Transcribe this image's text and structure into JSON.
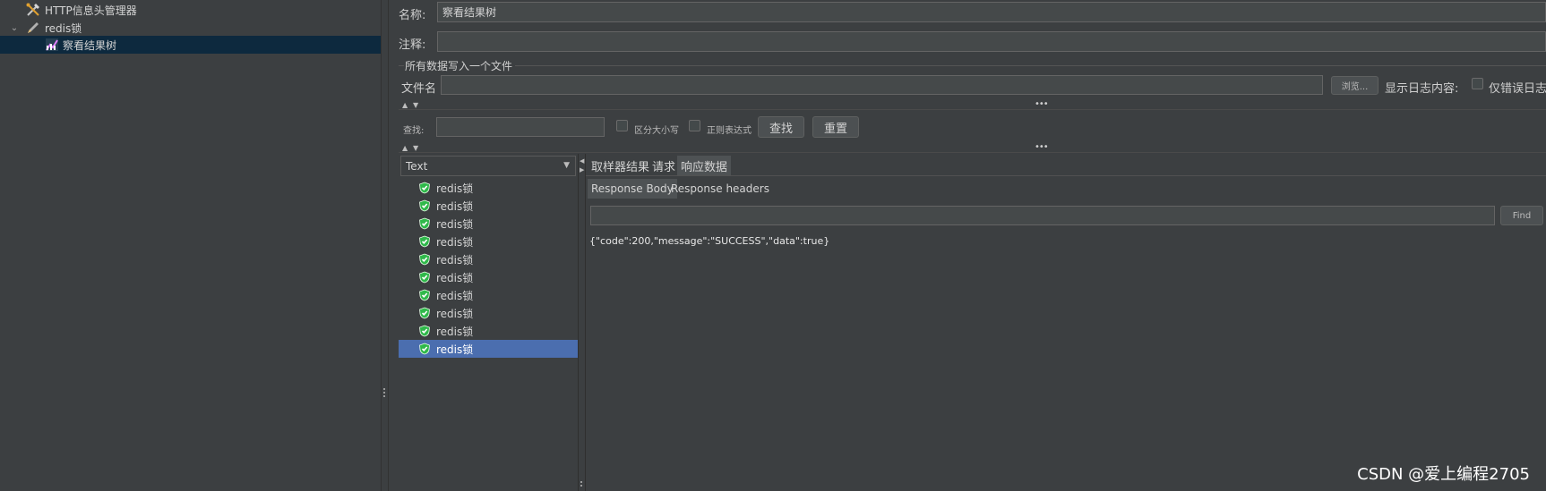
{
  "tree": {
    "items": [
      {
        "label": "HTTP信息头管理器",
        "icon": "wrench-screwdriver-icon"
      },
      {
        "label": "redis锁",
        "icon": "pencil-icon"
      },
      {
        "label": "察看结果树",
        "icon": "chart-icon"
      }
    ]
  },
  "form": {
    "name_label": "名称:",
    "name_value": "察看结果树",
    "comment_label": "注释:",
    "comment_value": "",
    "group_title": "所有数据写入一个文件",
    "filename_label": "文件名",
    "filename_value": "",
    "browse_label": "浏览...",
    "show_log_label": "显示日志内容:",
    "errors_only_label": "仅错误日志"
  },
  "search": {
    "label": "查找:",
    "value": "",
    "case_label": "区分大小写",
    "regex_label": "正则表达式",
    "find_button": "查找",
    "reset_button": "重置"
  },
  "results": {
    "renderer": "Text",
    "samples": [
      "redis锁",
      "redis锁",
      "redis锁",
      "redis锁",
      "redis锁",
      "redis锁",
      "redis锁",
      "redis锁",
      "redis锁",
      "redis锁"
    ],
    "tabs": [
      "取样器结果",
      "请求",
      "响应数据"
    ],
    "subtabs": [
      "Response Body",
      "Response headers"
    ],
    "find_value": "",
    "find_button": "Find",
    "body": "{\"code\":200,\"message\":\"SUCCESS\",\"data\":true}"
  },
  "colors": {
    "background": "#3c3f41",
    "selection": "#4b6eaf",
    "tree_selection": "#0d293e",
    "success_green": "#2fb84a"
  },
  "watermark": "CSDN @爱上编程2705"
}
